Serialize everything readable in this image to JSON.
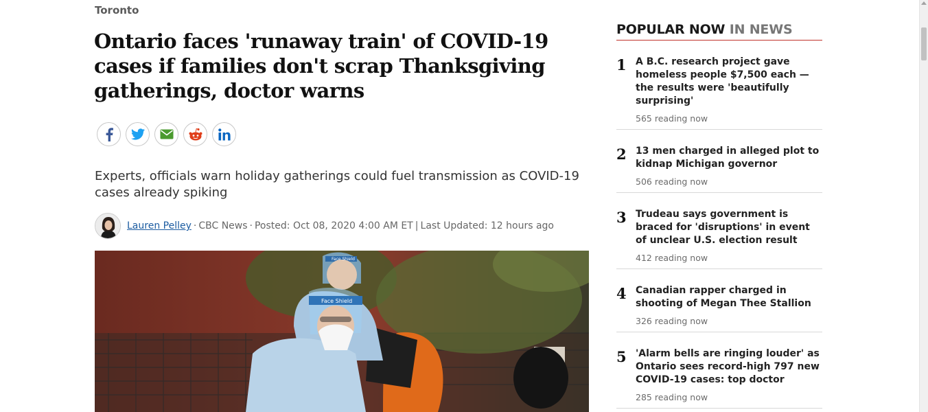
{
  "section": "Toronto",
  "headline": "Ontario faces 'runaway train' of COVID-19 cases if families don't scrap Thanksgiving gatherings, doctor warns",
  "share": {
    "icons": [
      "facebook-icon",
      "twitter-icon",
      "email-icon",
      "reddit-icon",
      "linkedin-icon"
    ],
    "colors": {
      "facebook": "#3b5998",
      "twitter": "#1da1f2",
      "email": "#4a9a2e",
      "reddit": "#e03e1a",
      "linkedin": "#0a66c2"
    }
  },
  "dek": "Experts, officials warn holiday gatherings could fuel transmission as COVID-19 cases already spiking",
  "byline": {
    "author": "Lauren Pelley",
    "outlet": "CBC News",
    "posted": "Posted: Oct 08, 2020 4:00 AM ET",
    "sep_dot": "·",
    "sep_bar": "|",
    "updated": "Last Updated: 12 hours ago"
  },
  "hero": {
    "badges": [
      "Face Shield",
      "Face Shield"
    ]
  },
  "popular": {
    "title": "POPULAR NOW",
    "title_accent": "IN NEWS",
    "accent_color": "#c0322b",
    "items": [
      {
        "rank": "1",
        "headline": "A B.C. research project gave homeless people $7,500 each — the results were 'beautifully surprising'",
        "reading": "565 reading now"
      },
      {
        "rank": "2",
        "headline": "13 men charged in alleged plot to kidnap Michigan governor",
        "reading": "506 reading now"
      },
      {
        "rank": "3",
        "headline": "Trudeau says government is braced for 'disruptions' in event of unclear U.S. election result",
        "reading": "412 reading now"
      },
      {
        "rank": "4",
        "headline": "Canadian rapper charged in shooting of Megan Thee Stallion",
        "reading": "326 reading now"
      },
      {
        "rank": "5",
        "headline": "'Alarm bells are ringing louder' as Ontario sees record-high 797 new COVID-19 cases: top doctor",
        "reading": "285 reading now"
      }
    ]
  }
}
